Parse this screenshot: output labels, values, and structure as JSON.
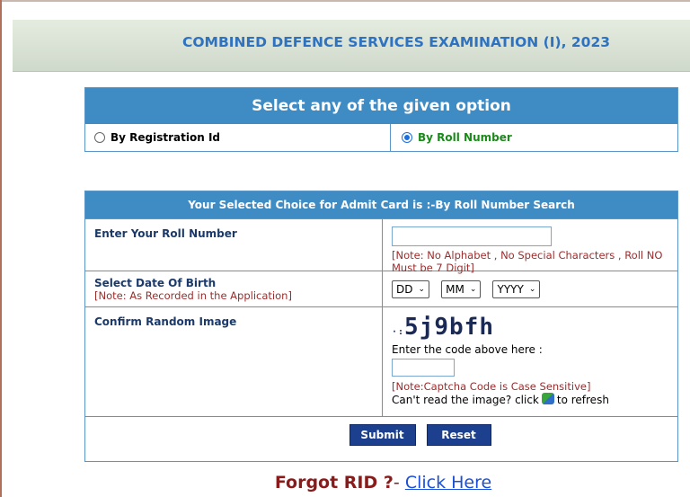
{
  "header": {
    "title": "COMBINED DEFENCE SERVICES EXAMINATION (I), 2023"
  },
  "options": {
    "heading": "Select any of the given option",
    "by_registration": "By Registration Id",
    "by_roll": "By Roll Number"
  },
  "form": {
    "heading": "Your Selected Choice for Admit Card is :-By Roll Number Search",
    "roll_label": "Enter Your Roll Number",
    "roll_value": "",
    "roll_note": "[Note: No Alphabet , No Special Characters , Roll NO Must be 7 Digit]",
    "dob_label": "Select Date Of Birth",
    "dob_note": "[Note: As Recorded in the Application]",
    "dd": "DD",
    "mm": "MM",
    "yyyy": "YYYY",
    "captcha_label": "Confirm Random Image",
    "captcha_text": "5j9bfh",
    "captcha_prompt": "Enter the code above here :",
    "captcha_value": "",
    "captcha_note": "[Note:Captcha Code is Case Sensitive]",
    "refresh_pre": "Can't read the image? click",
    "refresh_post": "to refresh",
    "submit": "Submit",
    "reset": "Reset"
  },
  "forgot": {
    "question": "Forgot RID ?",
    "sep": "- ",
    "link": "Click Here"
  },
  "colors": {
    "header_blue": "#3f8cc5",
    "title_blue": "#2f72c0",
    "button_navy": "#1c3f8e",
    "note_red": "#9b2d2d"
  }
}
